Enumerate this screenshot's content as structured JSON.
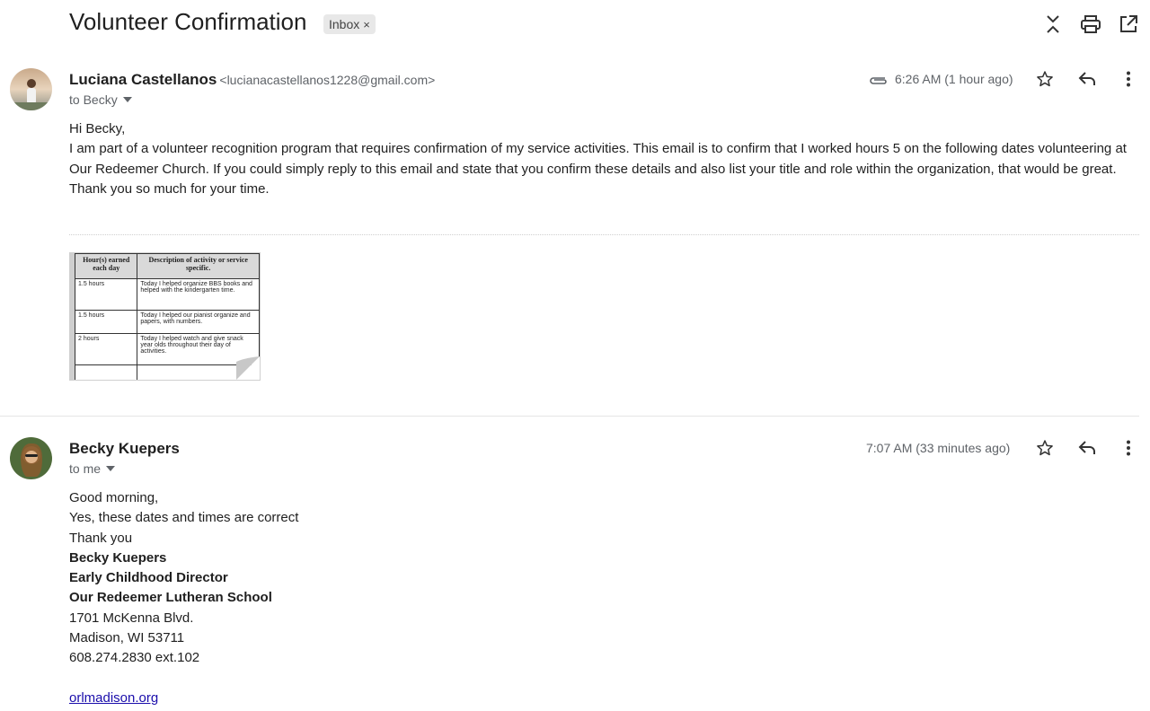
{
  "header": {
    "subject": "Volunteer Confirmation",
    "label": "Inbox",
    "label_close": "×"
  },
  "messages": [
    {
      "sender_name": "Luciana Castellanos",
      "sender_email": "<lucianacastellanos1228@gmail.com>",
      "to": "to Becky",
      "time": "6:26 AM (1 hour ago)",
      "body": [
        "Hi Becky,",
        "I am part of a volunteer recognition program that requires confirmation of my service activities. This email is to confirm that I worked hours 5 on the following dates volunteering at Our Redeemer Church. If you could simply reply to this email and state that you confirm these details and also list your title and role within the organization, that would be great. Thank you so much for your time."
      ],
      "attachment": {
        "headers": [
          "Hour(s) earned each day",
          "Description of activity or service specific."
        ],
        "rows": [
          [
            "1.5 hours",
            "Today I helped organize BBS books and helped with the kindergarten time."
          ],
          [
            "1.5 hours",
            "Today I helped our pianist organize and papers, with numbers."
          ],
          [
            "2 hours",
            "Today I helped watch and give snack year olds throughout their day of activities."
          ],
          [
            "",
            ""
          ]
        ]
      }
    },
    {
      "sender_name": "Becky Kuepers",
      "to": "to me",
      "time": "7:07 AM (33 minutes ago)",
      "body_lines": [
        "Good morning,",
        "Yes, these dates and times are correct",
        "Thank you"
      ],
      "signature_bold": [
        "Becky Kuepers",
        "Early Childhood Director",
        "Our Redeemer Lutheran School"
      ],
      "signature_plain": [
        "1701 McKenna Blvd.",
        "Madison, WI 53711",
        "608.274.2830 ext.102"
      ],
      "link": "orlmadison.org"
    }
  ],
  "icons": {
    "collapse": "collapse-all-icon",
    "print": "print-icon",
    "open_new": "open-in-new-window-icon",
    "attachment": "paperclip-icon",
    "star": "star-icon",
    "reply": "reply-icon",
    "more": "more-vert-icon",
    "dropdown": "caret-down-icon"
  },
  "colors": {
    "text": "#1f1f1f",
    "secondary": "#5f6368",
    "link": "#1a0dab",
    "chip_bg": "#e8e8e8"
  }
}
